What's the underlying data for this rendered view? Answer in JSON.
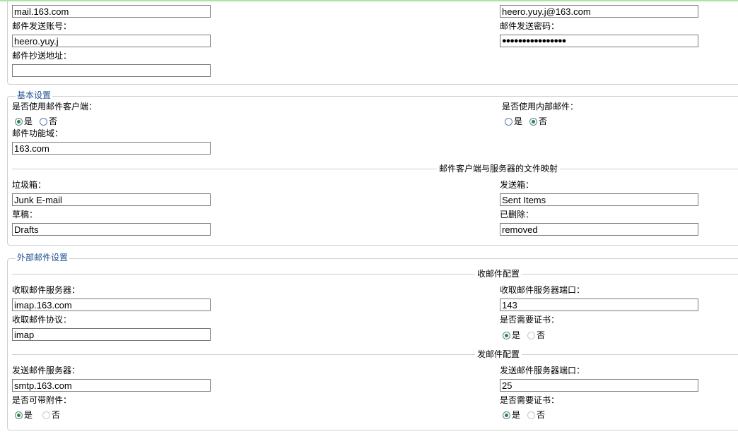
{
  "top": {
    "smtp_host_value": "mail.163.com",
    "sender_email_value": "heero.yuy.j@163.com",
    "send_account_label": "邮件发送账号：",
    "send_account_value": "heero.yuy.j",
    "send_password_label": "邮件发送密码：",
    "send_password_value": "●●●●●●●●●●●●●●●●",
    "cc_label": "邮件抄送地址：",
    "cc_value": ""
  },
  "basic": {
    "legend": "基本设置",
    "use_client_label": "是否使用邮件客户端：",
    "use_client_options": [
      "是",
      "否"
    ],
    "use_client_selected": "是",
    "use_internal_label": "是否使用内部邮件：",
    "use_internal_options": [
      "是",
      "否"
    ],
    "use_internal_selected": "否",
    "domain_label": "邮件功能域：",
    "domain_value": "163.com",
    "mapping_title": "邮件客户端与服务器的文件映射",
    "junk_label": "垃圾箱：",
    "junk_value": "Junk E-mail",
    "sent_label": "发送箱：",
    "sent_value": "Sent Items",
    "drafts_label": "草稿：",
    "drafts_value": "Drafts",
    "deleted_label": "已删除：",
    "deleted_value": "removed"
  },
  "external": {
    "legend": "外部邮件设置",
    "receive_title": "收邮件配置",
    "receive_server_label": "收取邮件服务器：",
    "receive_server_value": "imap.163.com",
    "receive_port_label": "收取邮件服务器端口：",
    "receive_port_value": "143",
    "receive_protocol_label": "收取邮件协议：",
    "receive_protocol_value": "imap",
    "receive_cert_label": "是否需要证书：",
    "receive_cert_options": [
      "是",
      "否"
    ],
    "receive_cert_selected": "是",
    "send_title": "发邮件配置",
    "send_server_label": "发送邮件服务器：",
    "send_server_value": "smtp.163.com",
    "send_port_label": "发送邮件服务器端口：",
    "send_port_value": "25",
    "attach_label": "是否可带附件：",
    "attach_options": [
      "是",
      "否"
    ],
    "attach_selected": "是",
    "send_cert_label": "是否需要证书：",
    "send_cert_options": [
      "是",
      "否"
    ],
    "send_cert_selected": "是"
  }
}
